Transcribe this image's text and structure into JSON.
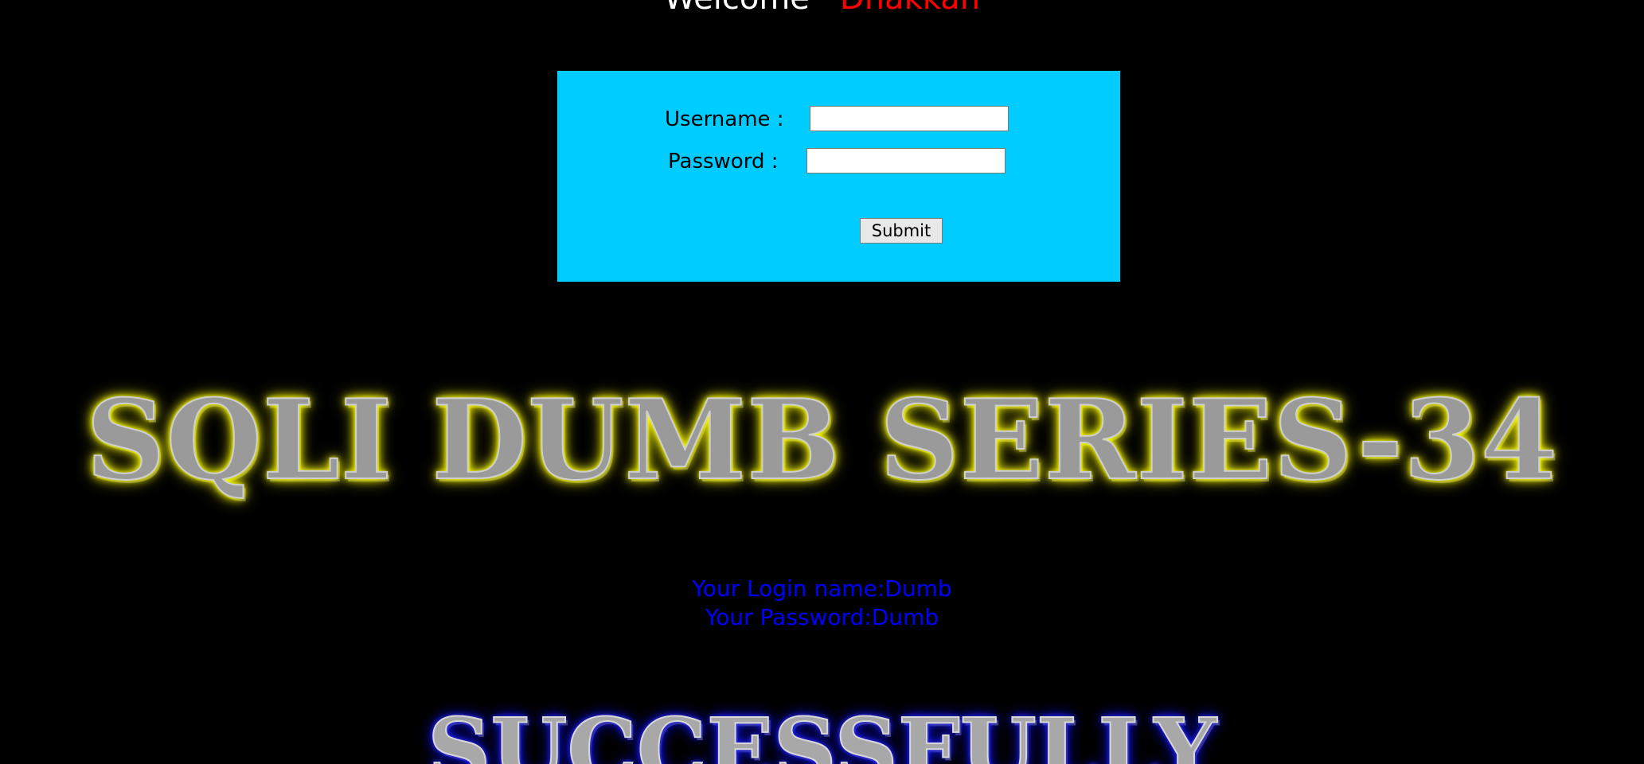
{
  "header": {
    "welcome_word": "Welcome",
    "welcome_name": "Dhakkan"
  },
  "login_form": {
    "username_label": "Username :",
    "username_value": "",
    "password_label": "Password :",
    "password_value": "",
    "submit_label": "Submit"
  },
  "banner": {
    "series_title": "SQLI DUMB SERIES-34",
    "success_title": "SUCCESSFULLY"
  },
  "result": {
    "login_line": "Your Login name:Dumb",
    "password_line": "Your Password:Dumb"
  },
  "colors": {
    "background": "#000000",
    "form_background": "#00ccff",
    "welcome_name": "#ff0000",
    "result_text": "#0000ff",
    "series_glow": "#ffff00",
    "success_glow": "#0000ff"
  }
}
